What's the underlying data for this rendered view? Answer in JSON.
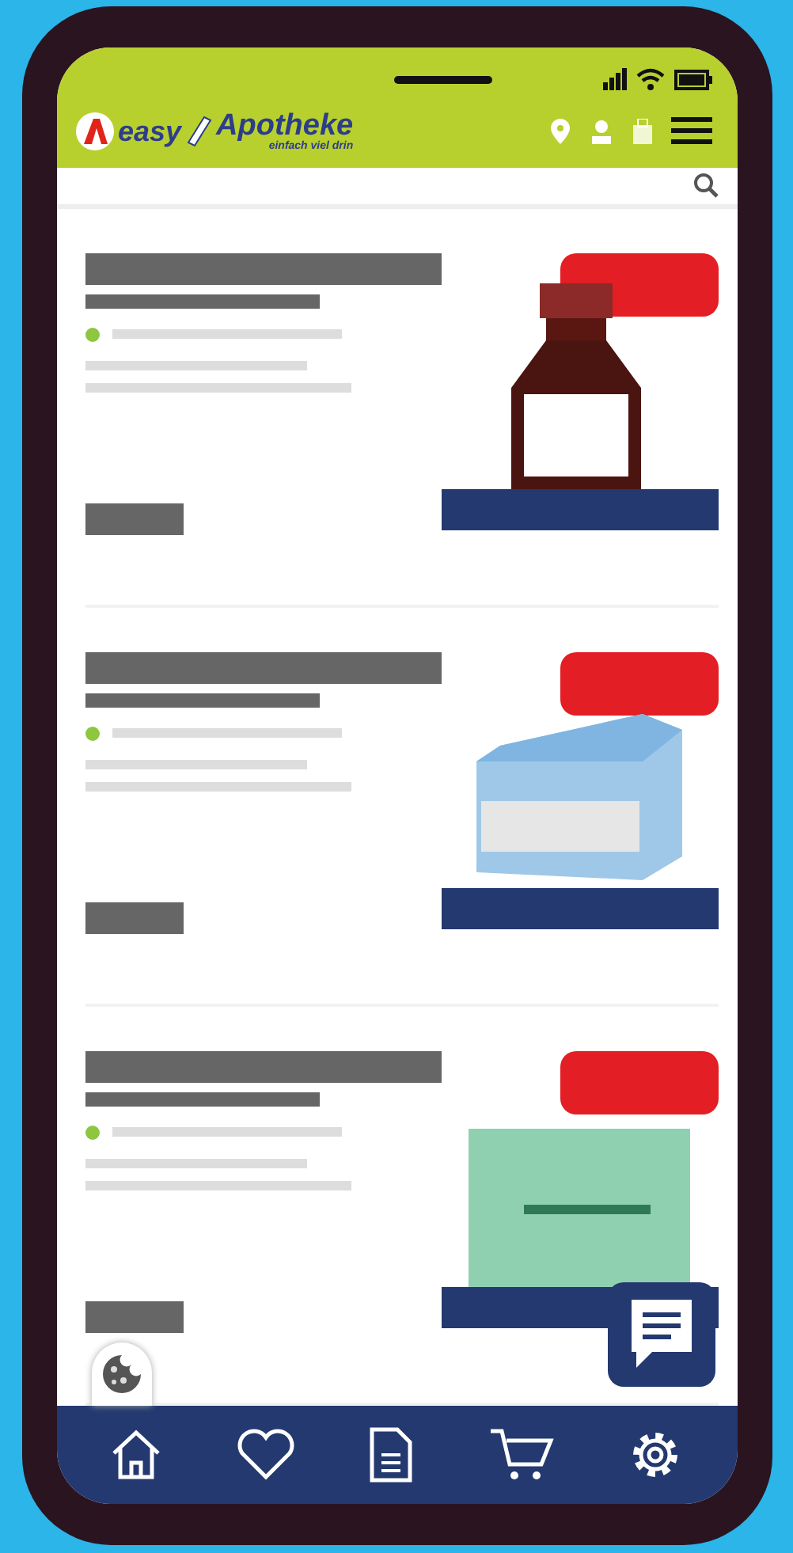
{
  "header": {
    "brand": "easy",
    "brand_name": "Apotheke",
    "slogan": "einfach viel drin"
  },
  "products": [
    {
      "kind": "bottle"
    },
    {
      "kind": "box"
    },
    {
      "kind": "pack"
    }
  ],
  "bottom_nav": [
    {
      "kind": "home"
    },
    {
      "kind": "heart"
    },
    {
      "kind": "document"
    },
    {
      "kind": "cart"
    },
    {
      "kind": "settings"
    }
  ]
}
